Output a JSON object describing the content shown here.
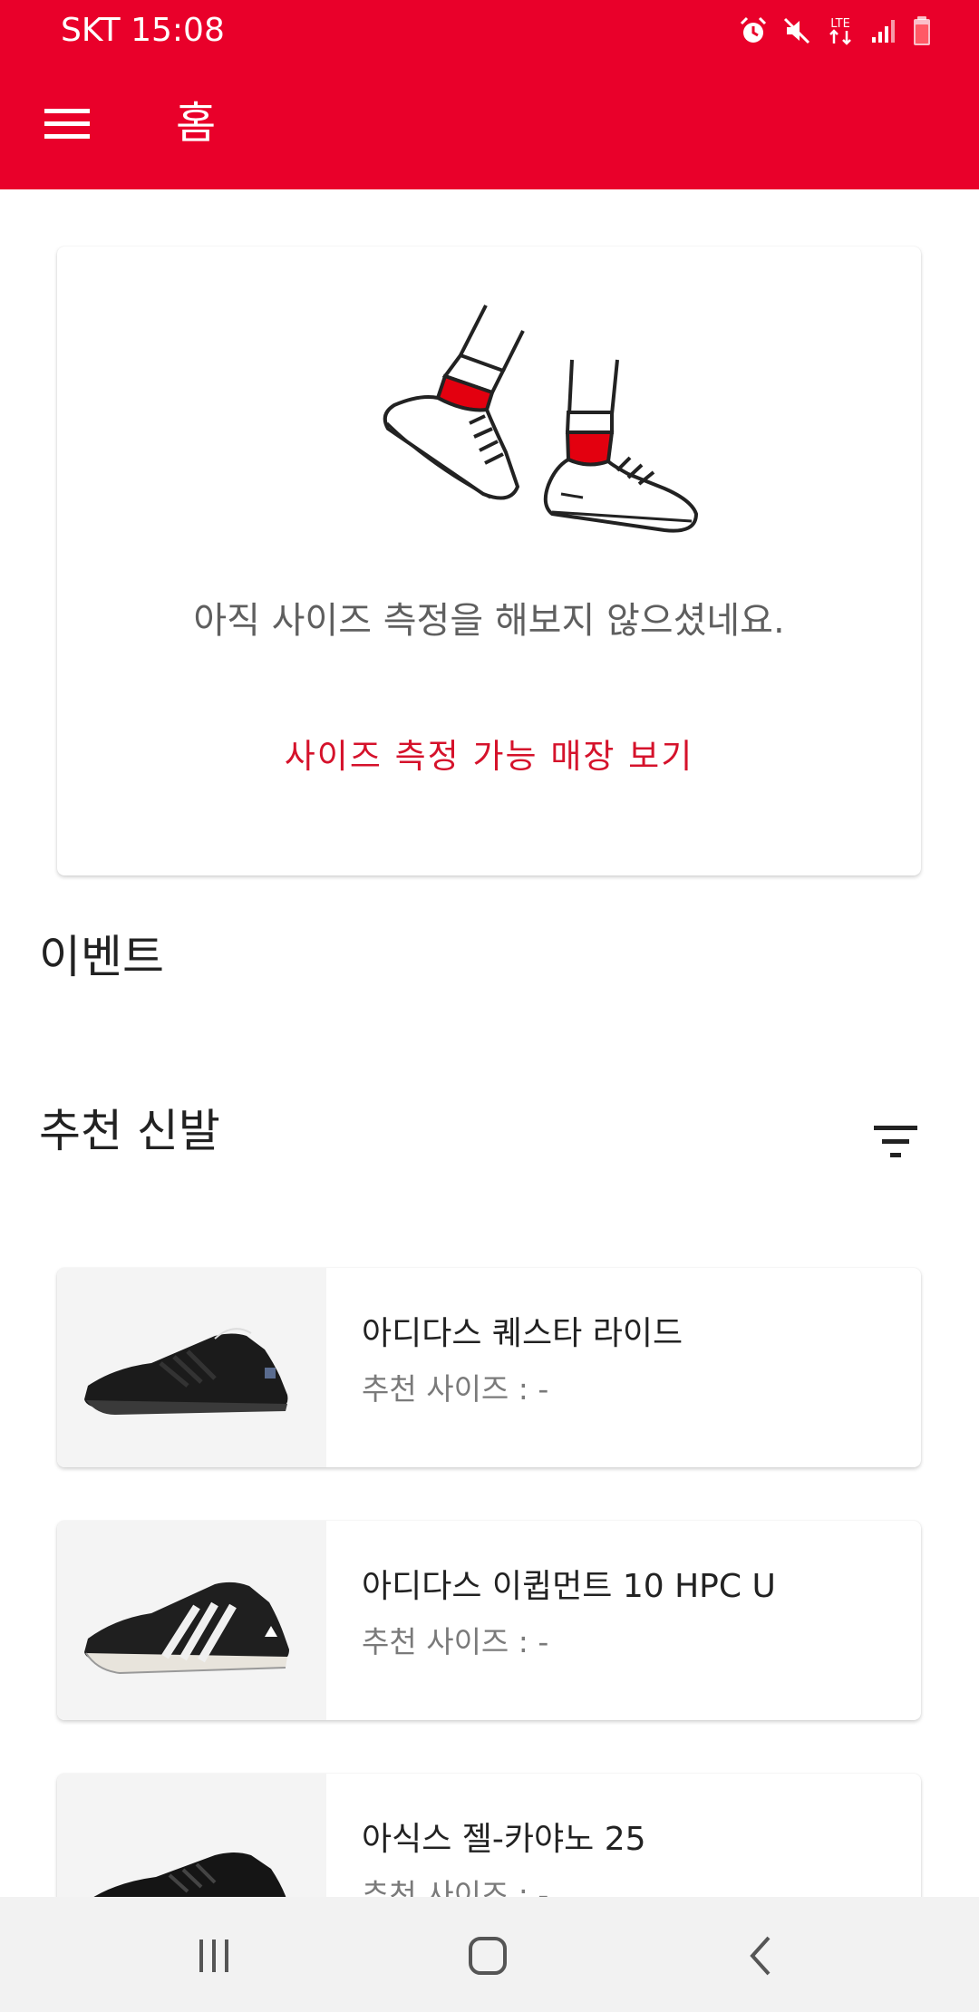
{
  "status_bar": {
    "carrier_time": "SKT 15:08",
    "network": "LTE"
  },
  "app_bar": {
    "title": "홈",
    "menu_icon": "hamburger-menu-icon"
  },
  "size_card": {
    "message": "아직 사이즈 측정을 해보지 않으셨네요.",
    "link_label": "사이즈 측정 가능 매장 보기",
    "illustration": "sneakers-illustration"
  },
  "sections": {
    "events": "이벤트",
    "recommended": "추천 신발",
    "filter_icon": "filter-icon"
  },
  "shoes": [
    {
      "name": "아디다스 퀘스타 라이드",
      "recommended_size": "추천 사이즈 : -"
    },
    {
      "name": "아디다스 이큅먼트 10 HPC U",
      "recommended_size": "추천 사이즈 : -"
    },
    {
      "name": "아식스 젤-카야노 25",
      "recommended_size": "추천 사이즈 : -"
    }
  ],
  "colors": {
    "brand": "#e9002a",
    "link": "#d5122b",
    "navbar_bg": "#f2f2f2"
  },
  "nav_bar": {
    "icons": [
      "recent-apps-icon",
      "home-icon",
      "back-icon"
    ]
  }
}
